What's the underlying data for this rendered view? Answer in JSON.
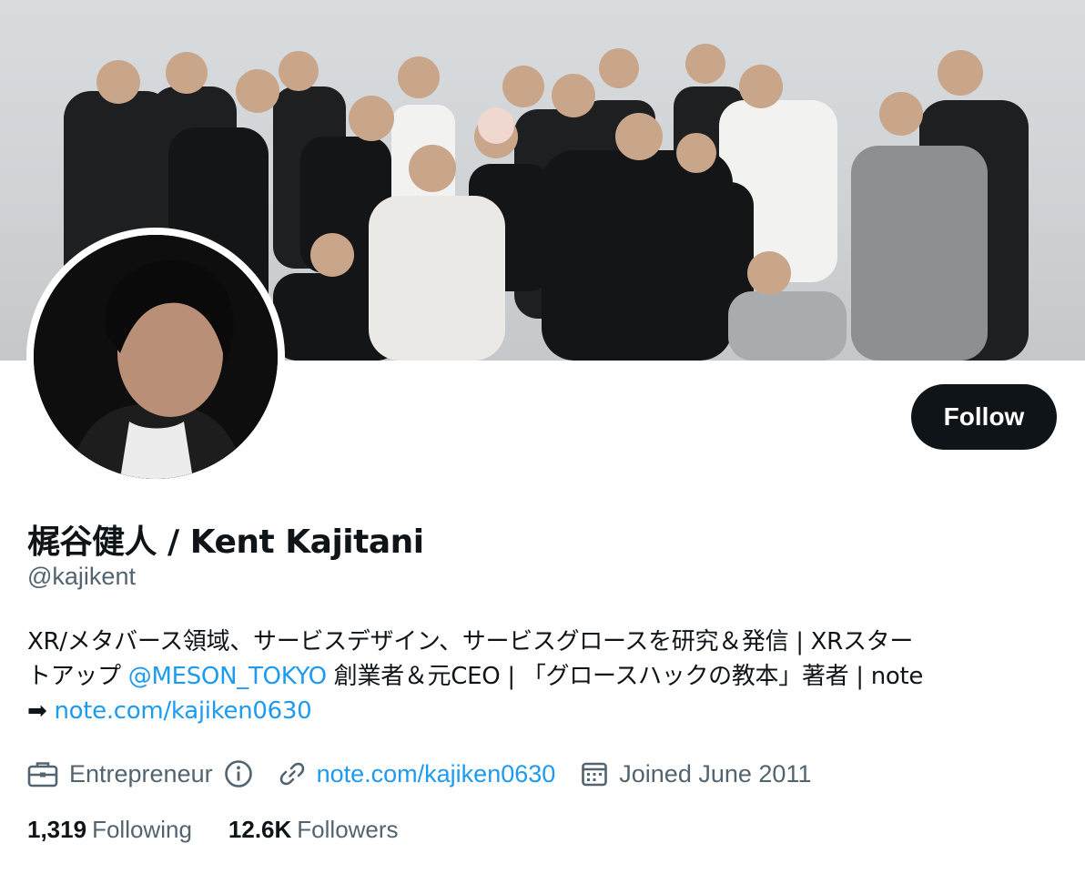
{
  "profile": {
    "display_name": "梶谷健人 / Kent Kajitani",
    "handle": "@kajikent",
    "follow_label": "Follow"
  },
  "bio": {
    "line1_text": "XR/メタバース領域、サービスデザイン、サービスグロースを研究＆発信 | XRスター",
    "line2_prefix": "トアップ ",
    "line2_mention": "@MESON_TOKYO",
    "line2_suffix": " 創業者＆元CEO | 「グロースハックの教本」著者 | note",
    "line3_arrow": "➡",
    "line3_link": "note.com/kajiken0630"
  },
  "meta": {
    "profession": "Entrepreneur",
    "profession_icon": "briefcase-icon",
    "info_icon": "info-icon",
    "website": "note.com/kajiken0630",
    "website_icon": "link-icon",
    "joined": "Joined June 2011",
    "joined_icon": "calendar-icon"
  },
  "stats": {
    "following_count": "1,319",
    "following_label": "Following",
    "followers_count": "12.6K",
    "followers_label": "Followers"
  },
  "colors": {
    "accent": "#1d9bf0",
    "text": "#0f1419",
    "secondary": "#536471",
    "button_bg": "#0f1419"
  }
}
